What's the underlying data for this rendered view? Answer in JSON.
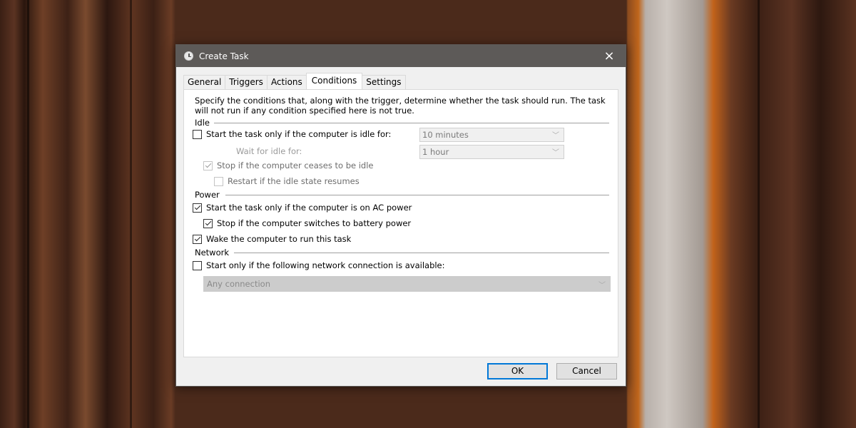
{
  "window": {
    "title": "Create Task",
    "icon": "clock-icon",
    "close_icon": "×"
  },
  "tabs": [
    {
      "label": "General",
      "active": false
    },
    {
      "label": "Triggers",
      "active": false
    },
    {
      "label": "Actions",
      "active": false
    },
    {
      "label": "Conditions",
      "active": true
    },
    {
      "label": "Settings",
      "active": false
    }
  ],
  "conditions": {
    "description": "Specify the conditions that, along with the trigger, determine whether the task should run.  The task will not run  if any condition specified here is not true.",
    "idle": {
      "group_label": "Idle",
      "start_if_idle": {
        "label": "Start the task only if the computer is idle for:",
        "checked": false
      },
      "idle_duration": {
        "value": "10 minutes"
      },
      "wait_for_idle": {
        "label": "Wait for idle for:",
        "value": "1 hour"
      },
      "stop_if_ceases_idle": {
        "label": "Stop if the computer ceases to be idle",
        "checked": true,
        "enabled": false
      },
      "restart_if_idle_resumes": {
        "label": "Restart if the idle state resumes",
        "checked": false,
        "enabled": false
      }
    },
    "power": {
      "group_label": "Power",
      "start_on_ac": {
        "label": "Start the task only if the computer is on AC power",
        "checked": true
      },
      "stop_on_battery": {
        "label": "Stop if the computer switches to battery power",
        "checked": true
      },
      "wake_to_run": {
        "label": "Wake the computer to run this task",
        "checked": true
      }
    },
    "network": {
      "group_label": "Network",
      "start_if_network": {
        "label": "Start only if the following network connection is available:",
        "checked": false
      },
      "connection": {
        "value": "Any connection"
      }
    }
  },
  "buttons": {
    "ok": "OK",
    "cancel": "Cancel"
  },
  "icons": {
    "chevron": "﹀"
  }
}
